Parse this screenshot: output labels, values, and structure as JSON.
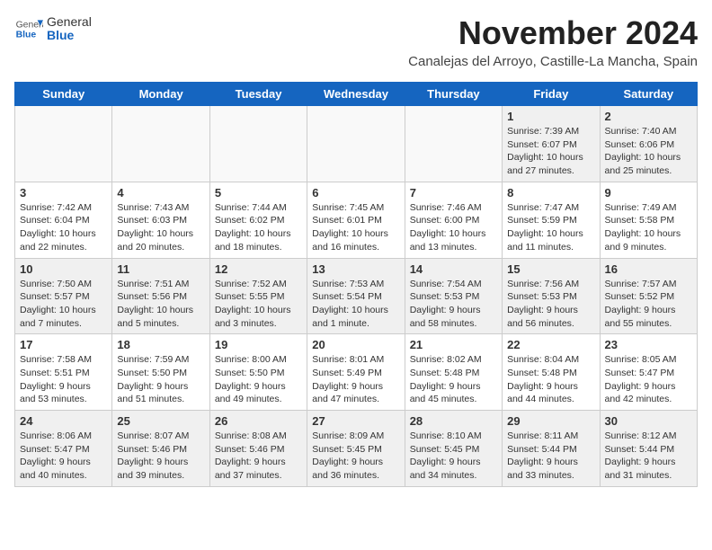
{
  "header": {
    "logo_general": "General",
    "logo_blue": "Blue",
    "month_title": "November 2024",
    "location": "Canalejas del Arroyo, Castille-La Mancha, Spain"
  },
  "weekdays": [
    "Sunday",
    "Monday",
    "Tuesday",
    "Wednesday",
    "Thursday",
    "Friday",
    "Saturday"
  ],
  "weeks": [
    [
      {
        "day": "",
        "info": ""
      },
      {
        "day": "",
        "info": ""
      },
      {
        "day": "",
        "info": ""
      },
      {
        "day": "",
        "info": ""
      },
      {
        "day": "",
        "info": ""
      },
      {
        "day": "1",
        "info": "Sunrise: 7:39 AM\nSunset: 6:07 PM\nDaylight: 10 hours and 27 minutes."
      },
      {
        "day": "2",
        "info": "Sunrise: 7:40 AM\nSunset: 6:06 PM\nDaylight: 10 hours and 25 minutes."
      }
    ],
    [
      {
        "day": "3",
        "info": "Sunrise: 7:42 AM\nSunset: 6:04 PM\nDaylight: 10 hours and 22 minutes."
      },
      {
        "day": "4",
        "info": "Sunrise: 7:43 AM\nSunset: 6:03 PM\nDaylight: 10 hours and 20 minutes."
      },
      {
        "day": "5",
        "info": "Sunrise: 7:44 AM\nSunset: 6:02 PM\nDaylight: 10 hours and 18 minutes."
      },
      {
        "day": "6",
        "info": "Sunrise: 7:45 AM\nSunset: 6:01 PM\nDaylight: 10 hours and 16 minutes."
      },
      {
        "day": "7",
        "info": "Sunrise: 7:46 AM\nSunset: 6:00 PM\nDaylight: 10 hours and 13 minutes."
      },
      {
        "day": "8",
        "info": "Sunrise: 7:47 AM\nSunset: 5:59 PM\nDaylight: 10 hours and 11 minutes."
      },
      {
        "day": "9",
        "info": "Sunrise: 7:49 AM\nSunset: 5:58 PM\nDaylight: 10 hours and 9 minutes."
      }
    ],
    [
      {
        "day": "10",
        "info": "Sunrise: 7:50 AM\nSunset: 5:57 PM\nDaylight: 10 hours and 7 minutes."
      },
      {
        "day": "11",
        "info": "Sunrise: 7:51 AM\nSunset: 5:56 PM\nDaylight: 10 hours and 5 minutes."
      },
      {
        "day": "12",
        "info": "Sunrise: 7:52 AM\nSunset: 5:55 PM\nDaylight: 10 hours and 3 minutes."
      },
      {
        "day": "13",
        "info": "Sunrise: 7:53 AM\nSunset: 5:54 PM\nDaylight: 10 hours and 1 minute."
      },
      {
        "day": "14",
        "info": "Sunrise: 7:54 AM\nSunset: 5:53 PM\nDaylight: 9 hours and 58 minutes."
      },
      {
        "day": "15",
        "info": "Sunrise: 7:56 AM\nSunset: 5:53 PM\nDaylight: 9 hours and 56 minutes."
      },
      {
        "day": "16",
        "info": "Sunrise: 7:57 AM\nSunset: 5:52 PM\nDaylight: 9 hours and 55 minutes."
      }
    ],
    [
      {
        "day": "17",
        "info": "Sunrise: 7:58 AM\nSunset: 5:51 PM\nDaylight: 9 hours and 53 minutes."
      },
      {
        "day": "18",
        "info": "Sunrise: 7:59 AM\nSunset: 5:50 PM\nDaylight: 9 hours and 51 minutes."
      },
      {
        "day": "19",
        "info": "Sunrise: 8:00 AM\nSunset: 5:50 PM\nDaylight: 9 hours and 49 minutes."
      },
      {
        "day": "20",
        "info": "Sunrise: 8:01 AM\nSunset: 5:49 PM\nDaylight: 9 hours and 47 minutes."
      },
      {
        "day": "21",
        "info": "Sunrise: 8:02 AM\nSunset: 5:48 PM\nDaylight: 9 hours and 45 minutes."
      },
      {
        "day": "22",
        "info": "Sunrise: 8:04 AM\nSunset: 5:48 PM\nDaylight: 9 hours and 44 minutes."
      },
      {
        "day": "23",
        "info": "Sunrise: 8:05 AM\nSunset: 5:47 PM\nDaylight: 9 hours and 42 minutes."
      }
    ],
    [
      {
        "day": "24",
        "info": "Sunrise: 8:06 AM\nSunset: 5:47 PM\nDaylight: 9 hours and 40 minutes."
      },
      {
        "day": "25",
        "info": "Sunrise: 8:07 AM\nSunset: 5:46 PM\nDaylight: 9 hours and 39 minutes."
      },
      {
        "day": "26",
        "info": "Sunrise: 8:08 AM\nSunset: 5:46 PM\nDaylight: 9 hours and 37 minutes."
      },
      {
        "day": "27",
        "info": "Sunrise: 8:09 AM\nSunset: 5:45 PM\nDaylight: 9 hours and 36 minutes."
      },
      {
        "day": "28",
        "info": "Sunrise: 8:10 AM\nSunset: 5:45 PM\nDaylight: 9 hours and 34 minutes."
      },
      {
        "day": "29",
        "info": "Sunrise: 8:11 AM\nSunset: 5:44 PM\nDaylight: 9 hours and 33 minutes."
      },
      {
        "day": "30",
        "info": "Sunrise: 8:12 AM\nSunset: 5:44 PM\nDaylight: 9 hours and 31 minutes."
      }
    ]
  ]
}
